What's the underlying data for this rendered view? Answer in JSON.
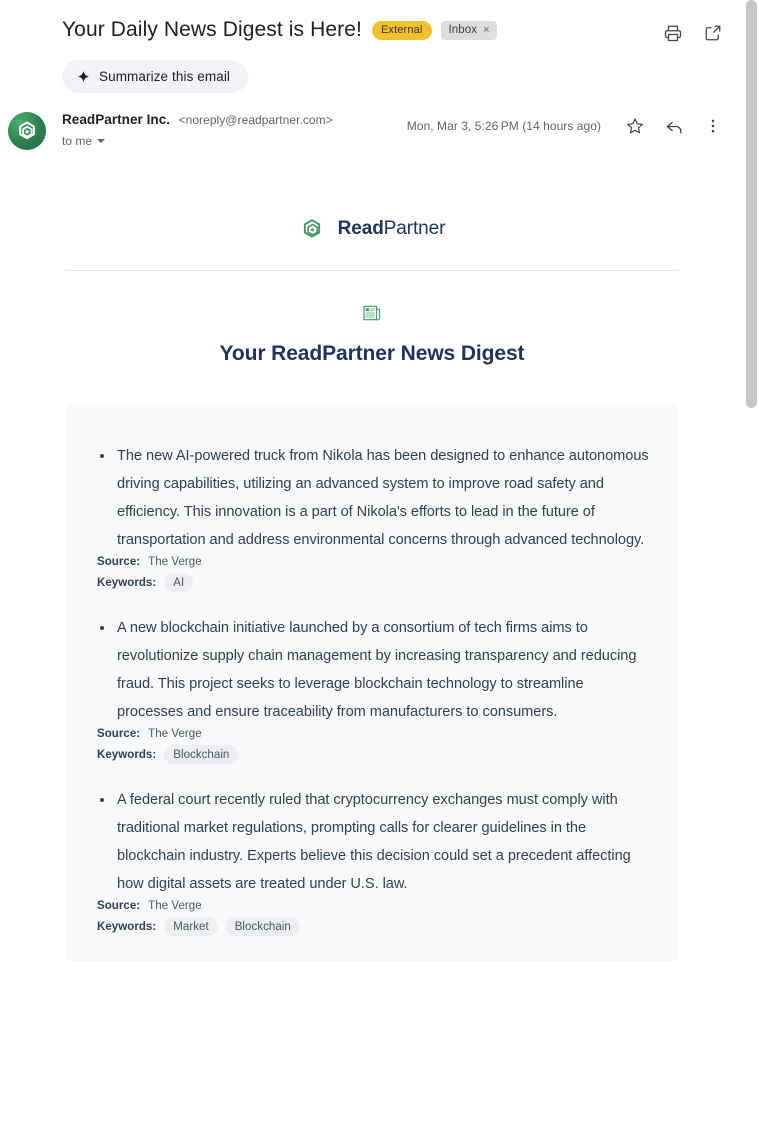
{
  "header": {
    "subject": "Your Daily News Digest is Here!",
    "external_badge": "External",
    "inbox_label": "Inbox",
    "inbox_remove": "×",
    "print_icon": "print-icon",
    "open_new_window_icon": "open-in-new-window-icon"
  },
  "summarize": {
    "label": "Summarize this email",
    "icon": "sparkle-icon"
  },
  "sender": {
    "avatar_icon": "readpartner-avatar-logo",
    "name": "ReadPartner Inc.",
    "email": "<noreply@readpartner.com>",
    "to": "to me",
    "timestamp": "Mon, Mar 3, 5:26 PM (14 hours ago)",
    "star_icon": "star-icon",
    "reply_icon": "reply-icon",
    "more_icon": "more-options-icon"
  },
  "body": {
    "brand": {
      "bold": "Read",
      "regular": "Partner",
      "logo_icon": "readpartner-hex-logo"
    },
    "digest_icon": "📰",
    "digest_title": "Your ReadPartner News Digest",
    "source_label": "Source:",
    "keywords_label": "Keywords:",
    "items": [
      {
        "text": "The new AI-powered truck from Nikola has been designed to enhance autonomous driving capabilities, utilizing an advanced system to improve road safety and efficiency. This innovation is a part of Nikola's efforts to lead in the future of transportation and address environmental concerns through advanced technology.",
        "source": "The Verge",
        "keywords": [
          "AI"
        ]
      },
      {
        "text": "A new blockchain initiative launched by a consortium of tech firms aims to revolutionize supply chain management by increasing transparency and reducing fraud. This project seeks to leverage blockchain technology to streamline processes and ensure traceability from manufacturers to consumers.",
        "source": "The Verge",
        "keywords": [
          "Blockchain"
        ]
      },
      {
        "text": "A federal court recently ruled that cryptocurrency exchanges must comply with traditional market regulations, prompting calls for clearer guidelines in the blockchain industry. Experts believe this decision could set a precedent affecting how digital assets are treated under U.S. law.",
        "source": "The Verge",
        "keywords": [
          "Market",
          "Blockchain"
        ]
      }
    ]
  },
  "colors": {
    "external_badge": "#f2c12e",
    "brand_navy": "#1f3560",
    "brand_green": "#3c9a5f",
    "card_bg": "#f8f9fa"
  }
}
